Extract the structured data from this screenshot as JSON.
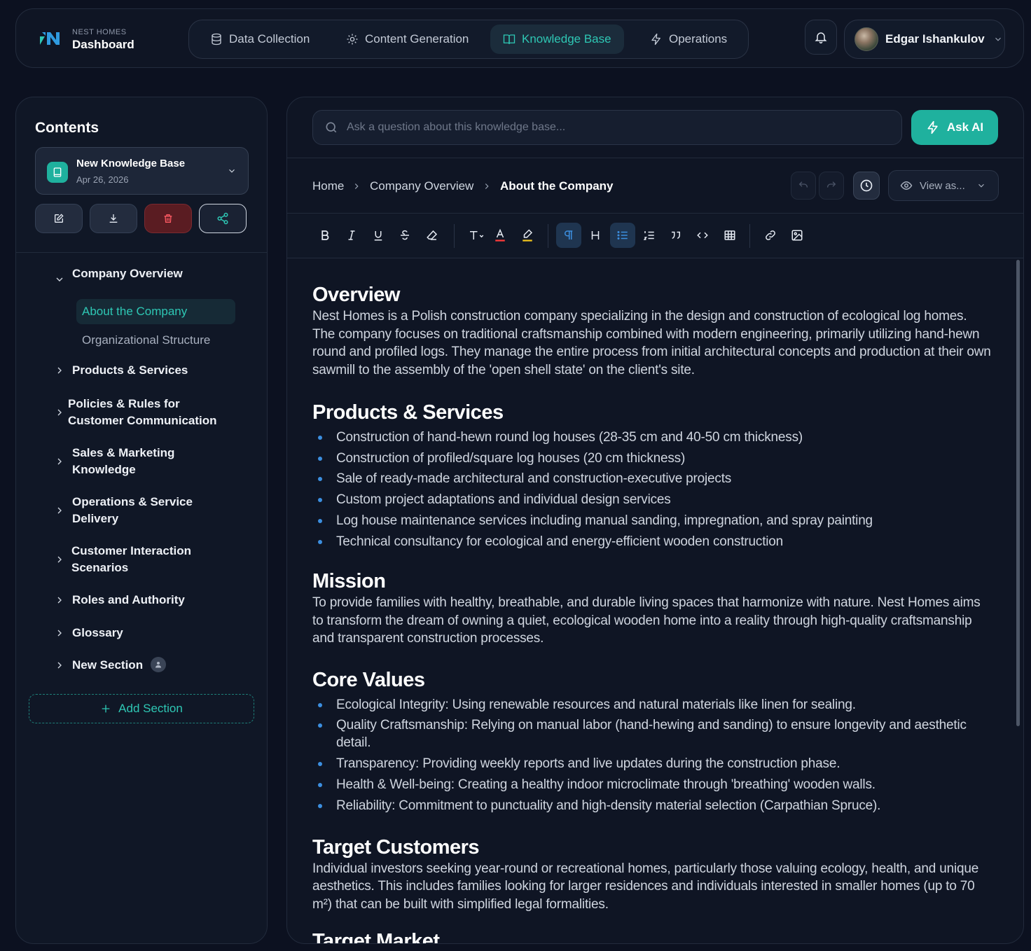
{
  "header": {
    "brand_small": "NEST HOMES",
    "brand_title": "Dashboard",
    "nav": [
      {
        "label": "Data Collection",
        "icon": "database-icon"
      },
      {
        "label": "Content Generation",
        "icon": "sparkle-icon"
      },
      {
        "label": "Knowledge Base",
        "icon": "book-open-icon",
        "active": true
      },
      {
        "label": "Operations",
        "icon": "bolt-icon"
      }
    ],
    "user_name": "Edgar Ishankulov"
  },
  "sidebar": {
    "title": "Contents",
    "kb_name": "New Knowledge Base",
    "kb_date": "Apr 26, 2026",
    "tree": [
      {
        "label": "Company Overview",
        "expanded": true
      },
      {
        "label": "About the Company",
        "active": true
      },
      {
        "label": "Organizational Structure"
      },
      {
        "label": "Products & Services"
      },
      {
        "label": "Policies & Rules for Customer Communication"
      },
      {
        "label": "Sales & Marketing Knowledge"
      },
      {
        "label": "Operations & Service Delivery"
      },
      {
        "label": "Customer Interaction Scenarios"
      },
      {
        "label": "Roles and Authority"
      },
      {
        "label": "Glossary"
      },
      {
        "label": "New Section"
      }
    ],
    "add_section": "Add Section"
  },
  "main": {
    "search_placeholder": "Ask a question about this knowledge base...",
    "ask_ai": "Ask AI",
    "breadcrumb": [
      "Home",
      "Company Overview",
      "About the Company"
    ],
    "view_as": "View as...",
    "accent": "#1fb19e"
  },
  "document": {
    "overview_title": "Overview",
    "overview_text": "Nest Homes is a Polish construction company specializing in the design and construction of ecological log homes. The company focuses on traditional craftsmanship combined with modern engineering, primarily utilizing hand-hewn round and profiled logs. They manage the entire process from initial architectural concepts and production at their own sawmill to the assembly of the 'open shell state' on the client's site.",
    "products_title": "Products & Services",
    "products": [
      "Construction of hand-hewn round log houses (28-35 cm and 40-50 cm thickness)",
      "Construction of profiled/square log houses (20 cm thickness)",
      "Sale of ready-made architectural and construction-executive projects",
      "Custom project adaptations and individual design services",
      "Log house maintenance services including manual sanding, impregnation, and spray painting",
      "Technical consultancy for ecological and energy-efficient wooden construction"
    ],
    "mission_title": "Mission",
    "mission_text": "To provide families with healthy, breathable, and durable living spaces that harmonize with nature. Nest Homes aims to transform the dream of owning a quiet, ecological wooden home into a reality through high-quality craftsmanship and transparent construction processes.",
    "values_title": "Core Values",
    "values": [
      "Ecological Integrity: Using renewable resources and natural materials like linen for sealing.",
      "Quality Craftsmanship: Relying on manual labor (hand-hewing and sanding) to ensure longevity and aesthetic detail.",
      "Transparency: Providing weekly reports and live updates during the construction phase.",
      "Health & Well-being: Creating a healthy indoor microclimate through 'breathing' wooden walls.",
      "Reliability: Commitment to punctuality and high-density material selection (Carpathian Spruce)."
    ],
    "target_title": "Target Customers",
    "target_text": "Individual investors seeking year-round or recreational homes, particularly those valuing ecology, health, and unique aesthetics. This includes families looking for larger residences and individuals interested in smaller homes (up to 70 m²) that can be built with simplified legal formalities.",
    "next_title": "Target Market"
  }
}
